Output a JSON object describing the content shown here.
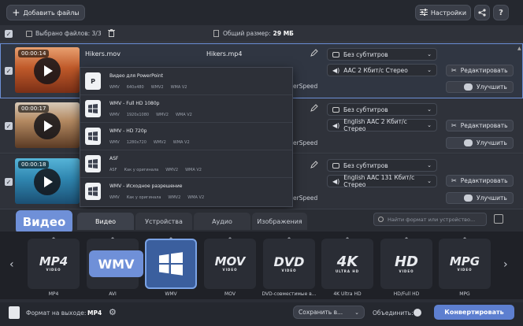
{
  "toolbar": {
    "add_files": "Добавить файлы",
    "settings": "Настройки"
  },
  "subbar": {
    "selected": "Выбрано файлов: 3/3",
    "total_size_label": "Общий размер:",
    "total_size_value": "29 МБ"
  },
  "files": [
    {
      "duration": "00:00:14",
      "name": "Hikers.mov",
      "output": "Hikers.mp4",
      "subtitles": "Без субтитров",
      "audio": "AAC 2 Кбит/с Стерео",
      "partial": "",
      "edit": "Редактировать",
      "enhance": "Улучшить"
    },
    {
      "duration": "00:00:17",
      "name": "",
      "output": "",
      "subtitles": "Без субтитров",
      "audio": "English AAC 2 Кбит/с Стерео",
      "partial": "erSpeed",
      "edit": "Редактировать",
      "enhance": "Улучшить"
    },
    {
      "duration": "00:00:18",
      "name": "",
      "output": "",
      "subtitles": "Без субтитров",
      "audio": "English AAC 131 Кбит/с Стерео",
      "partial": "erSpeed",
      "edit": "Редактировать",
      "enhance": "Улучшить"
    }
  ],
  "row0_partial": "erSpeed",
  "dropdown": [
    {
      "title": "Видео для PowerPoint",
      "specs": [
        "WMV",
        "640x480",
        "WMV2",
        "WMA V2"
      ]
    },
    {
      "title": "WMV - Full HD 1080p",
      "specs": [
        "WMV",
        "1920x1080",
        "WMV2",
        "WMA V2"
      ]
    },
    {
      "title": "WMV - HD 720p",
      "specs": [
        "WMV",
        "1280x720",
        "WMV2",
        "WMA V2"
      ]
    },
    {
      "title": "ASF",
      "specs": [
        "ASF",
        "Как у оригинала",
        "WMV2",
        "WMA V2"
      ]
    },
    {
      "title": "WMV - Исходное разрешение",
      "specs": [
        "WMV",
        "Как у оригинала",
        "WMV2",
        "WMA V2"
      ]
    }
  ],
  "tabs": {
    "badge": "Видео",
    "video": "Видео",
    "devices": "Устройства",
    "audio": "Аудио",
    "images": "Изображения",
    "search_placeholder": "Найти формат или устройство..."
  },
  "formats": [
    {
      "logo": "MP4",
      "sub": "VIDEO",
      "label": "MP4"
    },
    {
      "logo": "",
      "sub": "",
      "label": "AVI"
    },
    {
      "logo": "",
      "sub": "",
      "label": "WMV"
    },
    {
      "logo": "MOV",
      "sub": "VIDEO",
      "label": "MOV"
    },
    {
      "logo": "DVD",
      "sub": "VIDEO",
      "label": "DVD-совместимые в..."
    },
    {
      "logo": "4K",
      "sub": "ULTRA HD",
      "label": "4K Ultra HD"
    },
    {
      "logo": "HD",
      "sub": "VIDEO",
      "label": "HD/Full HD"
    },
    {
      "logo": "MPG",
      "sub": "VIDEO",
      "label": "MPG"
    }
  ],
  "wmv_badge": "WMV",
  "bottom": {
    "output_label": "Формат на выходе:",
    "output_value": "MP4",
    "save": "Сохранить в...",
    "merge": "Объединить:",
    "convert": "Конвертировать"
  },
  "colors": {
    "accent": "#6f90d8",
    "convert": "#5d7fd0"
  }
}
